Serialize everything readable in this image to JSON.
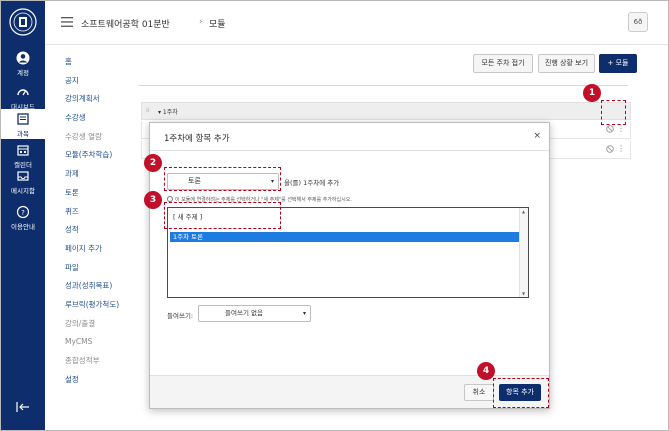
{
  "gnav": {
    "items": [
      {
        "label": "계정",
        "icon": "account-icon"
      },
      {
        "label": "대시보드",
        "icon": "dashboard-icon"
      },
      {
        "label": "과목",
        "icon": "courses-icon"
      },
      {
        "label": "캘린더",
        "icon": "calendar-icon"
      },
      {
        "label": "메시지함",
        "icon": "inbox-icon"
      },
      {
        "label": "이용안내",
        "icon": "help-icon"
      }
    ],
    "active_index": 2
  },
  "topbar": {
    "course_title": "소프트웨어공학 01분반",
    "breadcrumb_sep": "›",
    "breadcrumb_current": "모듈",
    "glasses_label": "6ð"
  },
  "course_nav": [
    {
      "label": "홈",
      "muted": false
    },
    {
      "label": "공지",
      "muted": false
    },
    {
      "label": "강의계획서",
      "muted": false
    },
    {
      "label": "수강생",
      "muted": false
    },
    {
      "label": "수강생 열람",
      "muted": true
    },
    {
      "label": "모듈(주차학습)",
      "muted": false
    },
    {
      "label": "과제",
      "muted": false
    },
    {
      "label": "토론",
      "muted": false
    },
    {
      "label": "퀴즈",
      "muted": false
    },
    {
      "label": "성적",
      "muted": false
    },
    {
      "label": "페이지 추가",
      "muted": false
    },
    {
      "label": "파일",
      "muted": false
    },
    {
      "label": "성과(성취목표)",
      "muted": false
    },
    {
      "label": "루브릭(평가척도)",
      "muted": false
    },
    {
      "label": "강의/출결",
      "muted": true
    },
    {
      "label": "MyCMS",
      "muted": true
    },
    {
      "label": "종합성적부",
      "muted": true
    },
    {
      "label": "설정",
      "muted": false
    }
  ],
  "toolbar": {
    "collapse_all": "모든 주차 접기",
    "view_progress": "진행 상황 보기",
    "add_module": "+ 모듈"
  },
  "module": {
    "header_title": "▾ 1주차"
  },
  "modal": {
    "title": "1주차에 항목 추가",
    "close": "×",
    "type_value": "토론",
    "type_suffix": "을(를) 1주차에 추가",
    "hint": "이 모듈에 연결하려는 주제를 선택하거나 \"새 주제\"를 선택해서 주제를 추가하십시오.",
    "options": [
      "[ 새 주제 ]",
      "1주차 토론"
    ],
    "selected_index": 1,
    "indent_label": "들여쓰기:",
    "indent_value": "들여쓰기 없음",
    "cancel": "취소",
    "submit": "항목 추가"
  },
  "callouts": [
    "1",
    "2",
    "3",
    "4"
  ],
  "colors": {
    "nav_bg": "#0e2d6d",
    "primary": "#0e2d6d",
    "selected": "#1e7be0",
    "callout": "#c0102a"
  }
}
